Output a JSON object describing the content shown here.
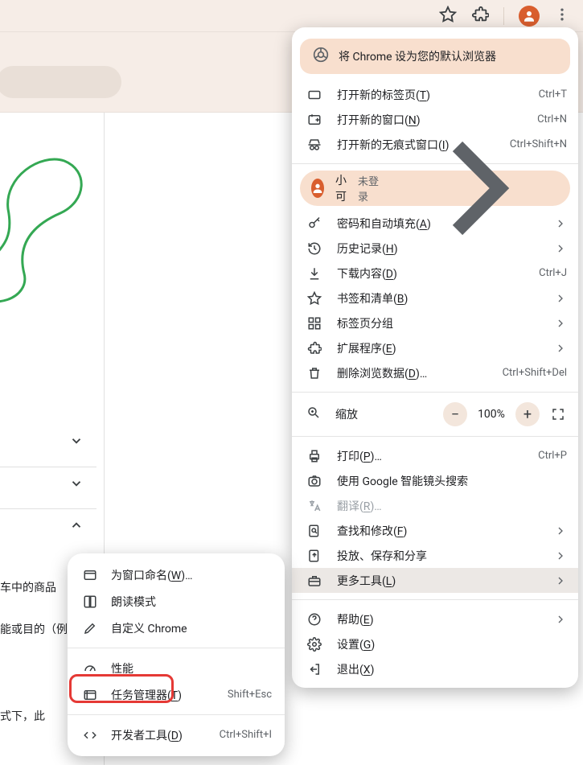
{
  "toolbar": {
    "star": "star-icon",
    "extension": "extension-icon",
    "profile": "profile-icon",
    "menu": "kebab-icon"
  },
  "background": {
    "accordion1": "down",
    "accordion2": "down",
    "accordion3": "up",
    "p1": "车中的商品",
    "p2": "能或目的（例",
    "p3": "式下，此"
  },
  "banner": {
    "text": "将 Chrome 设为您的默认浏览器"
  },
  "profile": {
    "name": "小可",
    "status": "未登录"
  },
  "zoom": {
    "label": "缩放",
    "value": "100%"
  },
  "items": {
    "newTab": {
      "label": "打开新的标签页(T)",
      "accel": "Ctrl+T"
    },
    "newWindow": {
      "label": "打开新的窗口(N)",
      "accel": "Ctrl+N"
    },
    "incognito": {
      "label": "打开新的无痕式窗口(I)",
      "accel": "Ctrl+Shift+N"
    },
    "passwords": {
      "label": "密码和自动填充(A)"
    },
    "history": {
      "label": "历史记录(H)"
    },
    "downloads": {
      "label": "下载内容(D)",
      "accel": "Ctrl+J"
    },
    "bookmarks": {
      "label": "书签和清单(B)"
    },
    "tabGroups": {
      "label": "标签页分组"
    },
    "extensions": {
      "label": "扩展程序(E)"
    },
    "clearData": {
      "label": "删除浏览数据(D)…",
      "accel": "Ctrl+Shift+Del"
    },
    "print": {
      "label": "打印(P)…",
      "accel": "Ctrl+P"
    },
    "lens": {
      "label": "使用 Google 智能镜头搜索"
    },
    "translate": {
      "label": "翻译(R)…"
    },
    "find": {
      "label": "查找和修改(F)"
    },
    "cast": {
      "label": "投放、保存和分享"
    },
    "moreTools": {
      "label": "更多工具(L)"
    },
    "help": {
      "label": "帮助(E)"
    },
    "settings": {
      "label": "设置(G)"
    },
    "exit": {
      "label": "退出(X)"
    }
  },
  "submenu": {
    "nameWindow": {
      "label": "为窗口命名(W)…"
    },
    "readMode": {
      "label": "朗读模式"
    },
    "customize": {
      "label": "自定义 Chrome"
    },
    "performance": {
      "label": "性能"
    },
    "taskManager": {
      "label": "任务管理器(T)",
      "accel": "Shift+Esc"
    },
    "devTools": {
      "label": "开发者工具(D)",
      "accel": "Ctrl+Shift+I"
    }
  }
}
